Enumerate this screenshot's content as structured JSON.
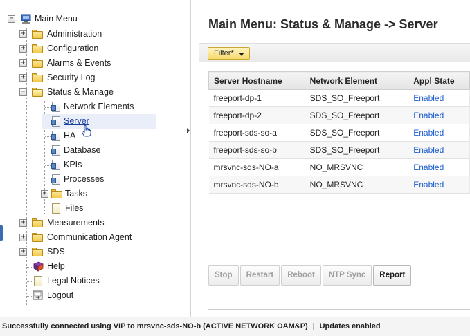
{
  "tree": {
    "root_label": "Main Menu",
    "items": [
      {
        "label": "Administration"
      },
      {
        "label": "Configuration"
      },
      {
        "label": "Alarms & Events"
      },
      {
        "label": "Security Log"
      },
      {
        "label": "Status & Manage"
      },
      {
        "label": "Network Elements"
      },
      {
        "label": "Server"
      },
      {
        "label": "HA"
      },
      {
        "label": "Database"
      },
      {
        "label": "KPIs"
      },
      {
        "label": "Processes"
      },
      {
        "label": "Tasks"
      },
      {
        "label": "Files"
      },
      {
        "label": "Measurements"
      },
      {
        "label": "Communication Agent"
      },
      {
        "label": "SDS"
      },
      {
        "label": "Help"
      },
      {
        "label": "Legal Notices"
      },
      {
        "label": "Logout"
      }
    ],
    "expand_glyph": "+",
    "collapse_glyph": "−"
  },
  "main": {
    "title": "Main Menu: Status & Manage -> Server",
    "filter_label": "Filter*",
    "table": {
      "columns": [
        "Server Hostname",
        "Network Element",
        "Appl State"
      ],
      "rows": [
        [
          "freeport-dp-1",
          "SDS_SO_Freeport",
          "Enabled"
        ],
        [
          "freeport-dp-2",
          "SDS_SO_Freeport",
          "Enabled"
        ],
        [
          "freeport-sds-so-a",
          "SDS_SO_Freeport",
          "Enabled"
        ],
        [
          "freeport-sds-so-b",
          "SDS_SO_Freeport",
          "Enabled"
        ],
        [
          "mrsvnc-sds-NO-a",
          "NO_MRSVNC",
          "Enabled"
        ],
        [
          "mrsvnc-sds-NO-b",
          "NO_MRSVNC",
          "Enabled"
        ]
      ]
    },
    "buttons": {
      "stop": "Stop",
      "restart": "Restart",
      "reboot": "Reboot",
      "ntp_sync": "NTP Sync",
      "report": "Report"
    }
  },
  "status_bar": {
    "connection": "Successfully connected using VIP to mrsvnc-sds-NO-b (ACTIVE NETWORK OAM&P)",
    "separator": "|",
    "updates": "Updates enabled"
  },
  "colors": {
    "link_blue": "#1e5fd0",
    "filter_yellow": "#f5d86a",
    "selection": "#e9eef9"
  }
}
